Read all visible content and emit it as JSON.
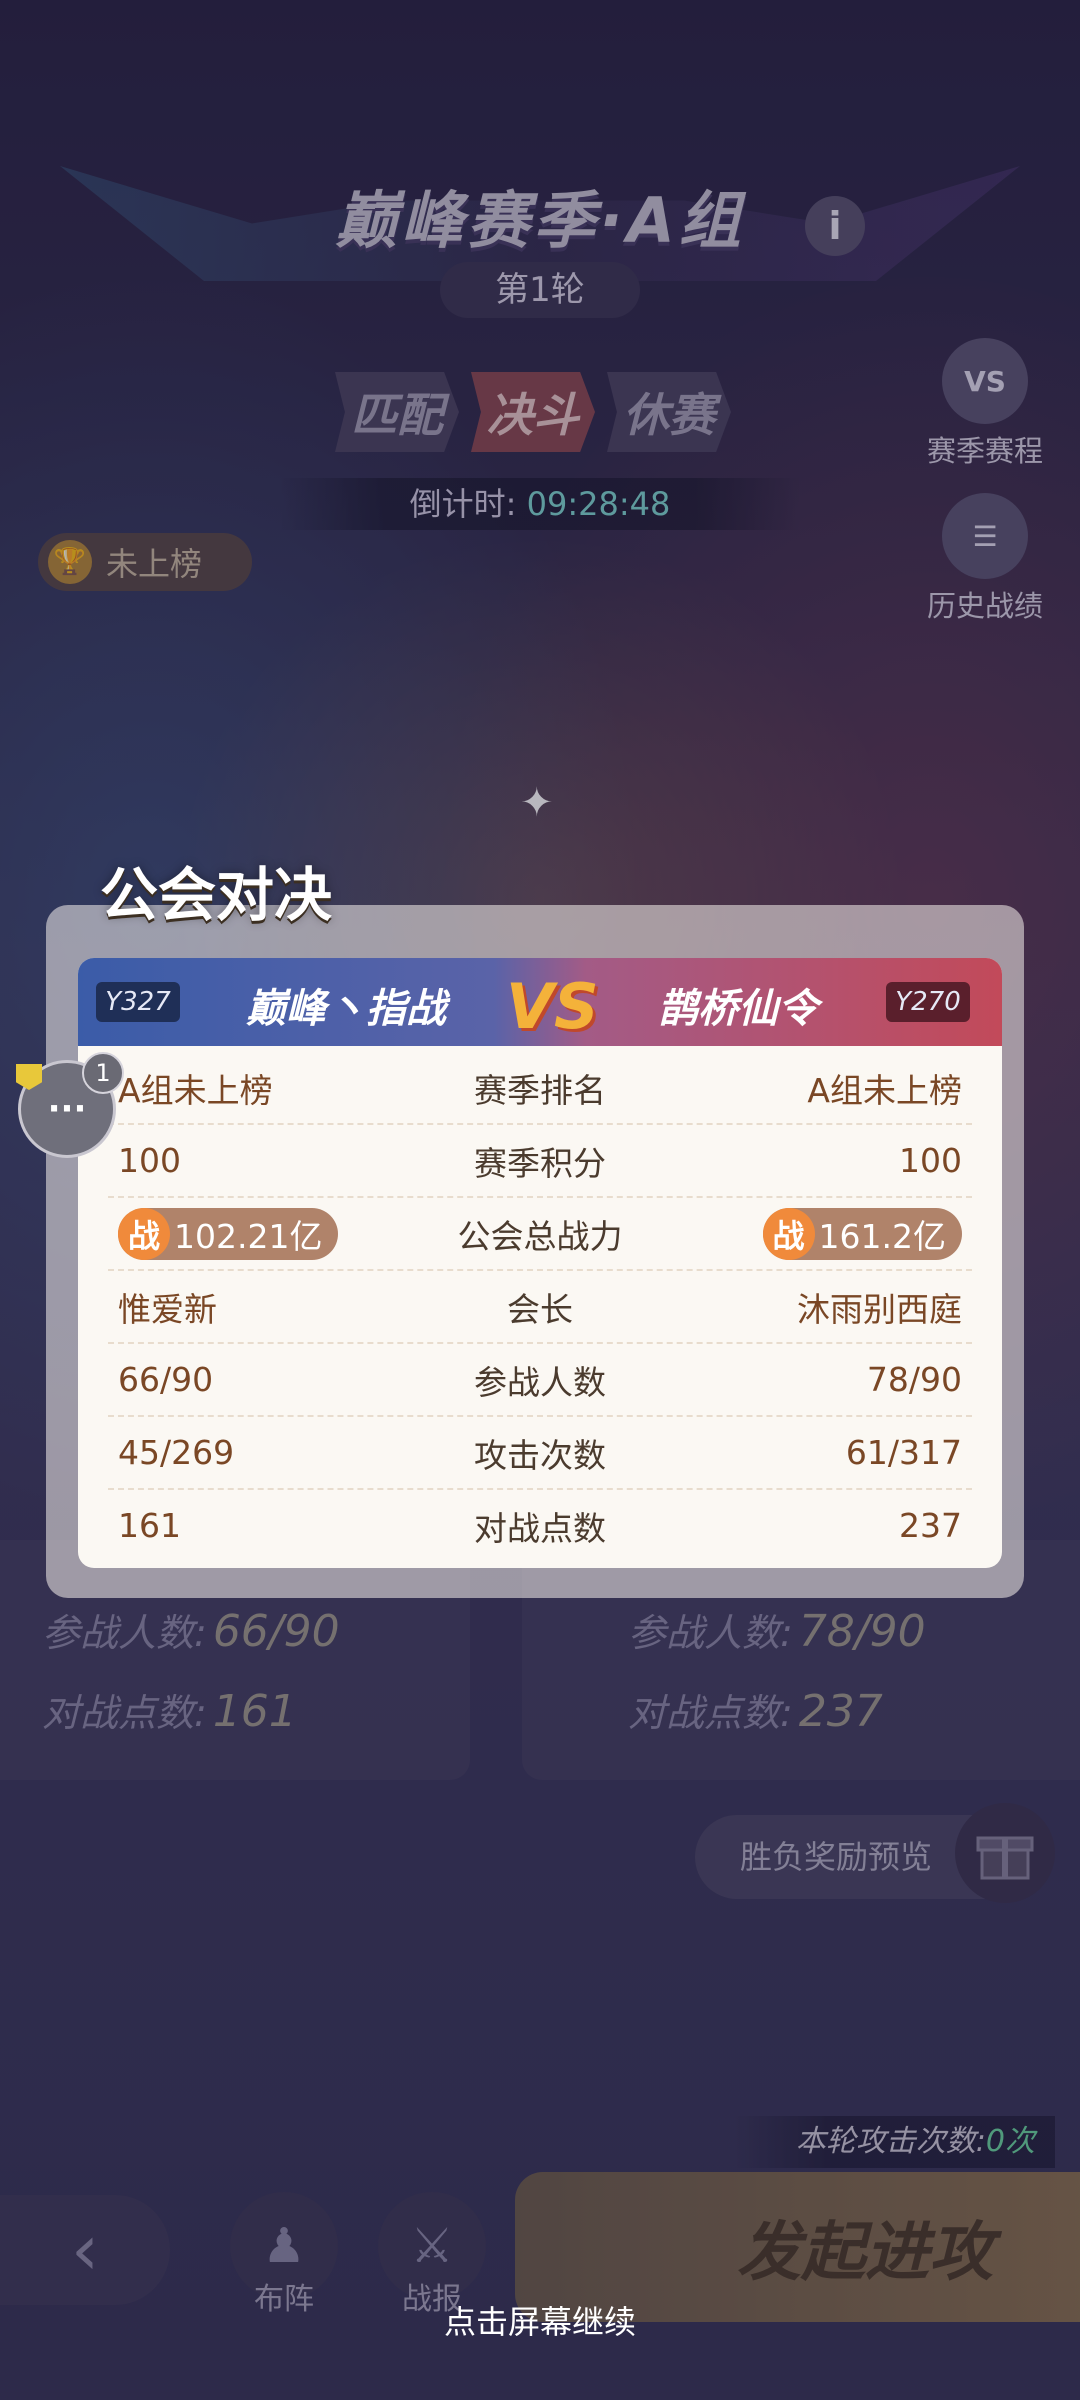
{
  "header": {
    "season_title": "巅峰赛季·A组",
    "info_icon": "i",
    "round": "第1轮",
    "phases": [
      "匹配",
      "决斗",
      "休赛"
    ],
    "active_phase_index": 1,
    "countdown_label": "倒计时:",
    "countdown_value": "09:28:48"
  },
  "side_buttons": [
    {
      "label": "赛季赛程",
      "icon": "calendar-vs-icon",
      "glyph": "VS"
    },
    {
      "label": "历史战绩",
      "icon": "list-icon",
      "glyph": "☰"
    }
  ],
  "rank_status": "未上榜",
  "modal": {
    "title": "公会对决",
    "left_team": {
      "tag": "Y327",
      "name": "巅峰丶指战",
      "color": "#3b5ca8"
    },
    "right_team": {
      "tag": "Y270",
      "name": "鹊桥仙令",
      "color": "#c24a5a"
    },
    "vs": "VS",
    "power_badge": "战",
    "rows": [
      {
        "label": "赛季排名",
        "left": "A组未上榜",
        "right": "A组未上榜"
      },
      {
        "label": "赛季积分",
        "left": "100",
        "right": "100"
      },
      {
        "label": "公会总战力",
        "left": "102.21亿",
        "right": "161.2亿",
        "is_power": true
      },
      {
        "label": "会长",
        "left": "惟爱新",
        "right": "沐雨别西庭"
      },
      {
        "label": "参战人数",
        "left": "66/90",
        "right": "78/90"
      },
      {
        "label": "攻击次数",
        "left": "45/269",
        "right": "61/317"
      },
      {
        "label": "对战点数",
        "left": "161",
        "right": "237"
      }
    ]
  },
  "chat": {
    "badge": "1",
    "glyph": "···"
  },
  "underlying": {
    "left": {
      "participants_label": "参战人数:",
      "participants": "66/90",
      "points_label": "对战点数:",
      "points": "161"
    },
    "right": {
      "participants_label": "参战人数:",
      "participants": "78/90",
      "points_label": "对战点数:",
      "points": "237"
    },
    "reward_preview": "胜负奖励预览",
    "attack_count_label": "本轮攻击次数:",
    "attack_count_value": "0次",
    "formation": "布阵",
    "report": "战报",
    "attack_button": "发起进攻"
  },
  "continue_hint": "点击屏幕继续"
}
